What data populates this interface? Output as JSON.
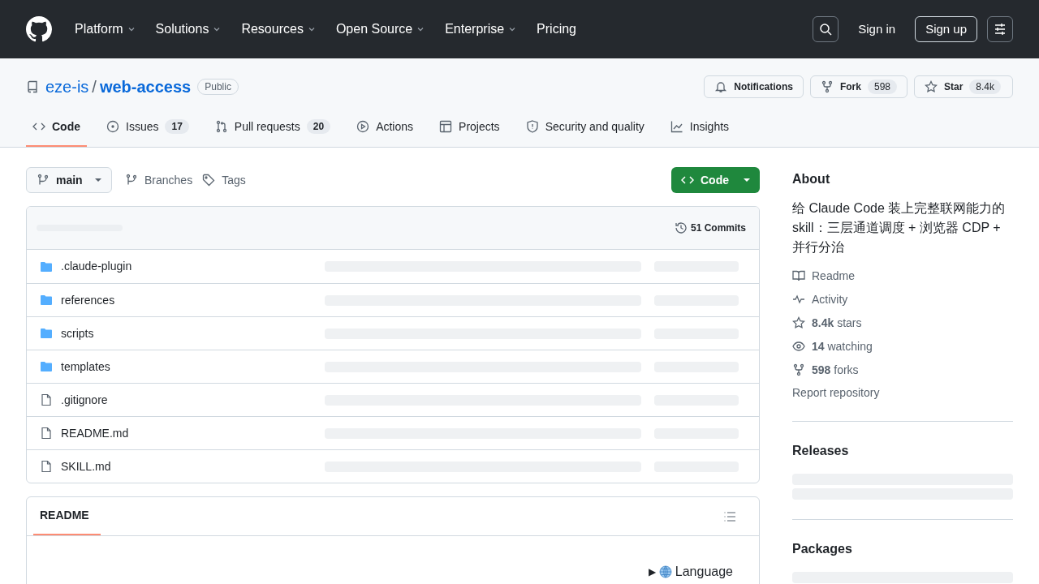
{
  "header": {
    "nav": [
      {
        "label": "Platform",
        "dropdown": true
      },
      {
        "label": "Solutions",
        "dropdown": true
      },
      {
        "label": "Resources",
        "dropdown": true
      },
      {
        "label": "Open Source",
        "dropdown": true
      },
      {
        "label": "Enterprise",
        "dropdown": true
      },
      {
        "label": "Pricing",
        "dropdown": false
      }
    ],
    "sign_in": "Sign in",
    "sign_up": "Sign up"
  },
  "repo": {
    "owner": "eze-is",
    "separator": "/",
    "name": "web-access",
    "visibility": "Public",
    "notifications": "Notifications",
    "fork": {
      "label": "Fork",
      "count": "598"
    },
    "star": {
      "label": "Star",
      "count": "8.4k"
    }
  },
  "tabs": [
    {
      "label": "Code",
      "selected": true
    },
    {
      "label": "Issues",
      "count": "17",
      "selected": false
    },
    {
      "label": "Pull requests",
      "count": "20",
      "selected": false
    },
    {
      "label": "Actions",
      "selected": false
    },
    {
      "label": "Projects",
      "selected": false
    },
    {
      "label": "Security and quality",
      "selected": false
    },
    {
      "label": "Insights",
      "selected": false
    }
  ],
  "toolbar": {
    "branch": "main",
    "branches": "Branches",
    "tags": "Tags",
    "code_button": "Code"
  },
  "files": {
    "commits": "51 Commits",
    "items": [
      {
        "name": ".claude-plugin",
        "kind": "folder"
      },
      {
        "name": "references",
        "kind": "folder"
      },
      {
        "name": "scripts",
        "kind": "folder"
      },
      {
        "name": "templates",
        "kind": "folder"
      },
      {
        "name": ".gitignore",
        "kind": "file"
      },
      {
        "name": "README.md",
        "kind": "file"
      },
      {
        "name": "SKILL.md",
        "kind": "file"
      }
    ]
  },
  "readme": {
    "tabs": [
      {
        "label": "README",
        "selected": true
      }
    ],
    "toggle": "▶",
    "language": "Language"
  },
  "about": {
    "title": "About",
    "description": "给 Claude Code 装上完整联网能力的 skill：三层通道调度 + 浏览器 CDP + 并行分治",
    "links": [
      "Readme",
      "Activity",
      "**8.4k** stars",
      "**14** watching",
      "**598** forks"
    ],
    "report": "Report repository"
  },
  "sections": [
    "Releases",
    "Packages"
  ]
}
